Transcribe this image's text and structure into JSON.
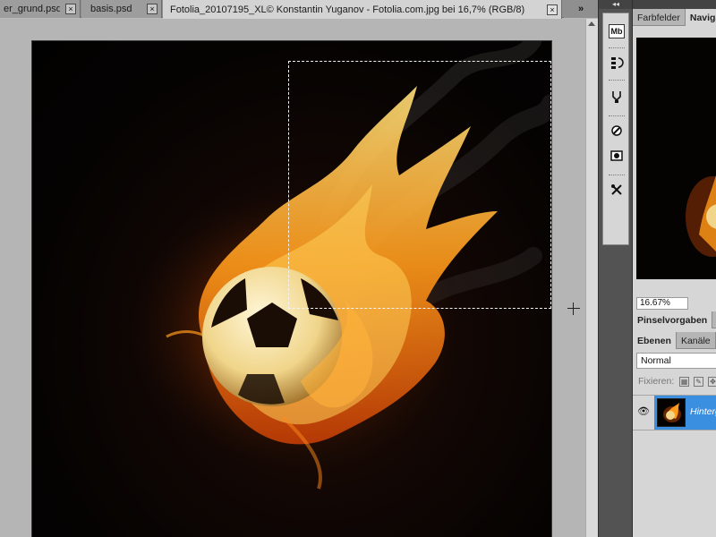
{
  "tabs": [
    {
      "label": "er_grund.psd",
      "active": false
    },
    {
      "label": "basis.psd",
      "active": false
    },
    {
      "label": "Fotolia_20107195_XL© Konstantin Yuganov - Fotolia.com.jpg bei 16,7% (RGB/8)",
      "active": true
    }
  ],
  "tab_close_glyph": "×",
  "tab_overflow": "»",
  "panel_collapse": "◂◂",
  "toolbar": {
    "mb_label": "Mb",
    "icons": [
      "mini-bridge-icon",
      "history-icon",
      "actions-icon",
      "brush-presets-icon",
      "clone-source-icon",
      "tool-presets-icon"
    ]
  },
  "panels": {
    "top_tabs": [
      "Farbfelder",
      "Navigator"
    ],
    "zoom_value": "16.67%",
    "brush_tab": "Pinselvorgaben",
    "layer_tabs": [
      "Ebenen",
      "Kanäle"
    ],
    "blend_mode": "Normal",
    "lock_label": "Fixieren:",
    "layer_name": "Hintergrund"
  },
  "colors": {
    "accent_selection": "#3a8fe0",
    "navigator_frame": "#d32020"
  }
}
